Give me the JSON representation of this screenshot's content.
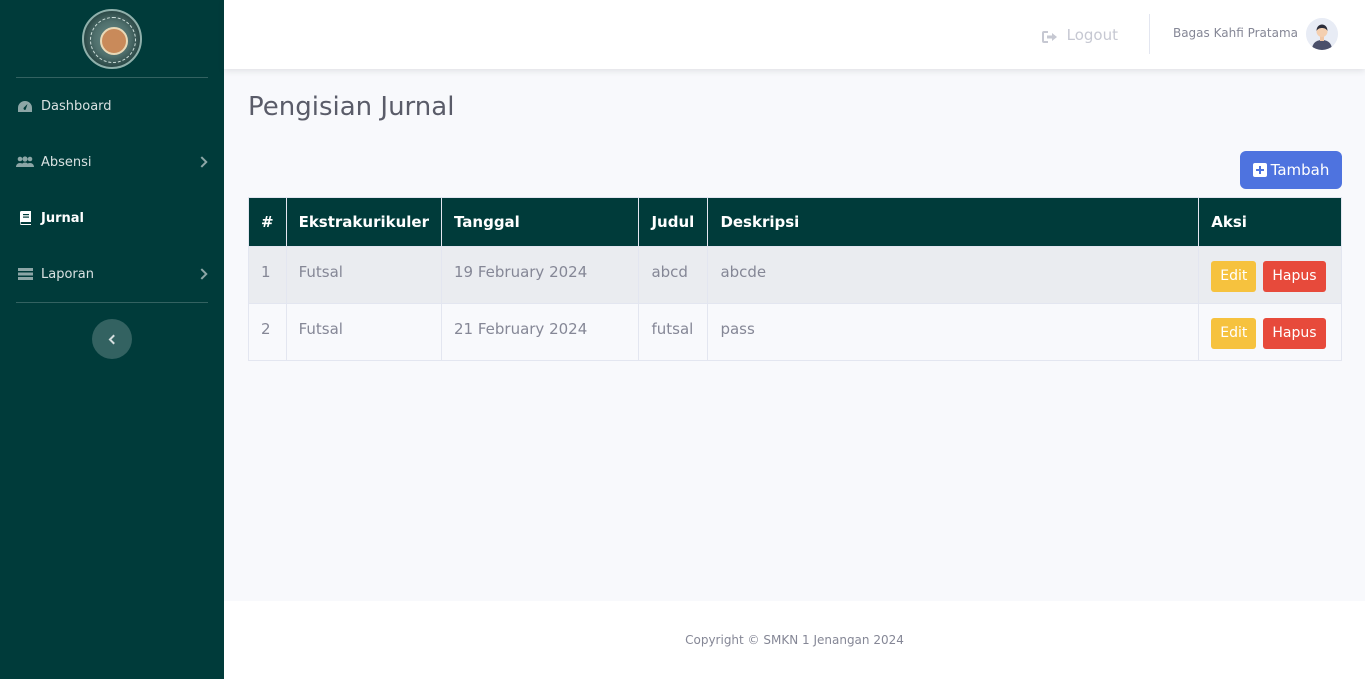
{
  "sidebar": {
    "items": [
      {
        "label": "Dashboard",
        "icon": "dashboard-icon"
      },
      {
        "label": "Absensi",
        "icon": "users-icon"
      },
      {
        "label": "Jurnal",
        "icon": "book-icon"
      },
      {
        "label": "Laporan",
        "icon": "table-icon"
      }
    ]
  },
  "topbar": {
    "logout_label": "Logout",
    "user_name": "Bagas Kahfi Pratama"
  },
  "main": {
    "title": "Pengisian Jurnal",
    "add_label": "Tambah",
    "table": {
      "headers": [
        "#",
        "Ekstrakurikuler",
        "Tanggal",
        "Judul",
        "Deskripsi",
        "Aksi"
      ],
      "rows": [
        {
          "no": "1",
          "ekskul": "Futsal",
          "tanggal": "19 February 2024",
          "judul": "abcd",
          "deskripsi": "abcde"
        },
        {
          "no": "2",
          "ekskul": "Futsal",
          "tanggal": "21 February 2024",
          "judul": "futsal",
          "deskripsi": "pass"
        }
      ],
      "edit_label": "Edit",
      "delete_label": "Hapus"
    }
  },
  "footer": {
    "copyright": "Copyright © SMKN 1 Jenangan 2024"
  },
  "colors": {
    "sidebar": "#003b3a",
    "primary": "#4e73df",
    "warning": "#f6c23e",
    "danger": "#e74a3b"
  }
}
